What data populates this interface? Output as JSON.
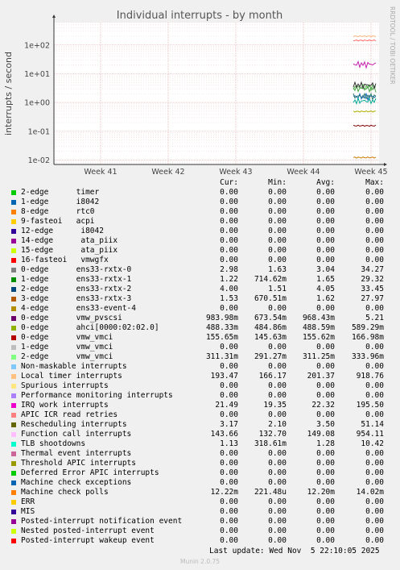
{
  "chart_data": {
    "type": "line",
    "title": "Individual interrupts - by month",
    "ylabel": "interrupts / second",
    "yscale": "log",
    "ylim": [
      0.007,
      600
    ],
    "y_ticks": [
      {
        "v": 100,
        "label": "1e+02"
      },
      {
        "v": 10,
        "label": "1e+01"
      },
      {
        "v": 1,
        "label": "1e+00"
      },
      {
        "v": 0.1,
        "label": "1e-01"
      },
      {
        "v": 0.01,
        "label": "1e-02"
      }
    ],
    "x_ticks": [
      "Week 41",
      "Week 42",
      "Week 43",
      "Week 44",
      "Week 45"
    ],
    "grid": true,
    "side_text": "RRDTOOL / TOBI OETIKER",
    "series_visible": [
      {
        "color": "#f8b67e",
        "level": 201.37
      },
      {
        "color": "#ff6a6a",
        "level": 143.66
      },
      {
        "color": "#c51eb0",
        "level": 21.49
      },
      {
        "color": "#5db055",
        "level": 3.5
      },
      {
        "color": "#4da84a",
        "level": 3.04
      },
      {
        "color": "#333333",
        "level": 4.05
      },
      {
        "color": "#1565c0",
        "level": 1.62
      },
      {
        "color": "#2e7d6b",
        "level": 1.65
      },
      {
        "color": "#00a896",
        "level": 1.13
      },
      {
        "color": "#b0b000",
        "level": 0.4883
      },
      {
        "color": "#7d0000",
        "level": 0.1557
      },
      {
        "color": "#cc7a00",
        "level": 0.01222
      }
    ]
  },
  "legend": {
    "headers": [
      "Cur:",
      "Min:",
      "Avg:",
      "Max:"
    ],
    "rows": [
      {
        "name": "2-edge      timer",
        "color": "#00cc00",
        "cur": "0.00",
        "min": "0.00",
        "avg": "0.00",
        "max": "0.00"
      },
      {
        "name": "1-edge      i8042",
        "color": "#0066b3",
        "cur": "0.00",
        "min": "0.00",
        "avg": "0.00",
        "max": "0.00"
      },
      {
        "name": "8-edge      rtc0",
        "color": "#ff8000",
        "cur": "0.00",
        "min": "0.00",
        "avg": "0.00",
        "max": "0.00"
      },
      {
        "name": "9-fasteoi   acpi",
        "color": "#ffcc00",
        "cur": "0.00",
        "min": "0.00",
        "avg": "0.00",
        "max": "0.00"
      },
      {
        "name": "12-edge      i8042",
        "color": "#330099",
        "cur": "0.00",
        "min": "0.00",
        "avg": "0.00",
        "max": "0.00"
      },
      {
        "name": "14-edge      ata_piix",
        "color": "#990099",
        "cur": "0.00",
        "min": "0.00",
        "avg": "0.00",
        "max": "0.00"
      },
      {
        "name": "15-edge      ata_piix",
        "color": "#ccff00",
        "cur": "0.00",
        "min": "0.00",
        "avg": "0.00",
        "max": "0.00"
      },
      {
        "name": "16-fasteoi   vmwgfx",
        "color": "#ff0000",
        "cur": "0.00",
        "min": "0.00",
        "avg": "0.00",
        "max": "0.00"
      },
      {
        "name": "0-edge      ens33-rxtx-0",
        "color": "#808080",
        "cur": "2.98",
        "min": "1.63",
        "avg": "3.04",
        "max": "34.27"
      },
      {
        "name": "1-edge      ens33-rxtx-1",
        "color": "#008f00",
        "cur": "1.22",
        "min": "714.62m",
        "avg": "1.65",
        "max": "29.32"
      },
      {
        "name": "2-edge      ens33-rxtx-2",
        "color": "#00487d",
        "cur": "4.00",
        "min": "1.51",
        "avg": "4.05",
        "max": "33.45"
      },
      {
        "name": "3-edge      ens33-rxtx-3",
        "color": "#b35a00",
        "cur": "1.53",
        "min": "670.51m",
        "avg": "1.62",
        "max": "27.97"
      },
      {
        "name": "4-edge      ens33-event-4",
        "color": "#b38f00",
        "cur": "0.00",
        "min": "0.00",
        "avg": "0.00",
        "max": "0.00"
      },
      {
        "name": "0-edge      vmw_pvscsi",
        "color": "#6b006b",
        "cur": "983.98m",
        "min": "673.54m",
        "avg": "968.43m",
        "max": "5.21"
      },
      {
        "name": "0-edge      ahci[0000:02:02.0]",
        "color": "#8fb300",
        "cur": "488.33m",
        "min": "484.86m",
        "avg": "488.59m",
        "max": "589.29m"
      },
      {
        "name": "0-edge      vmw_vmci",
        "color": "#b30000",
        "cur": "155.65m",
        "min": "145.63m",
        "avg": "155.62m",
        "max": "166.98m"
      },
      {
        "name": "1-edge      vmw_vmci",
        "color": "#bebebe",
        "cur": "0.00",
        "min": "0.00",
        "avg": "0.00",
        "max": "0.00"
      },
      {
        "name": "2-edge      vmw_vmci",
        "color": "#80ff80",
        "cur": "311.31m",
        "min": "291.27m",
        "avg": "311.25m",
        "max": "333.96m"
      },
      {
        "name": "Non-maskable interrupts",
        "color": "#80c9ff",
        "cur": "0.00",
        "min": "0.00",
        "avg": "0.00",
        "max": "0.00"
      },
      {
        "name": "Local timer interrupts",
        "color": "#ffc080",
        "cur": "193.47",
        "min": "166.17",
        "avg": "201.37",
        "max": "918.76"
      },
      {
        "name": "Spurious interrupts",
        "color": "#ffe680",
        "cur": "0.00",
        "min": "0.00",
        "avg": "0.00",
        "max": "0.00"
      },
      {
        "name": "Performance monitoring interrupts",
        "color": "#aa80ff",
        "cur": "0.00",
        "min": "0.00",
        "avg": "0.00",
        "max": "0.00"
      },
      {
        "name": "IRQ work interrupts",
        "color": "#ee00cc",
        "cur": "21.49",
        "min": "19.35",
        "avg": "22.32",
        "max": "195.50"
      },
      {
        "name": "APIC ICR read retries",
        "color": "#ff8080",
        "cur": "0.00",
        "min": "0.00",
        "avg": "0.00",
        "max": "0.00"
      },
      {
        "name": "Rescheduling interrupts",
        "color": "#666600",
        "cur": "3.17",
        "min": "2.10",
        "avg": "3.50",
        "max": "51.14"
      },
      {
        "name": "Function call interrupts",
        "color": "#ffbfff",
        "cur": "143.66",
        "min": "132.70",
        "avg": "149.08",
        "max": "954.11"
      },
      {
        "name": "TLB shootdowns",
        "color": "#00ffcc",
        "cur": "1.13",
        "min": "318.61m",
        "avg": "1.28",
        "max": "10.42"
      },
      {
        "name": "Thermal event interrupts",
        "color": "#cc6699",
        "cur": "0.00",
        "min": "0.00",
        "avg": "0.00",
        "max": "0.00"
      },
      {
        "name": "Threshold APIC interrupts",
        "color": "#999900",
        "cur": "0.00",
        "min": "0.00",
        "avg": "0.00",
        "max": "0.00"
      },
      {
        "name": "Deferred Error APIC interrupts",
        "color": "#00cc00",
        "cur": "0.00",
        "min": "0.00",
        "avg": "0.00",
        "max": "0.00"
      },
      {
        "name": "Machine check exceptions",
        "color": "#0066b3",
        "cur": "0.00",
        "min": "0.00",
        "avg": "0.00",
        "max": "0.00"
      },
      {
        "name": "Machine check polls",
        "color": "#ff8000",
        "cur": "12.22m",
        "min": "221.48u",
        "avg": "12.20m",
        "max": "14.02m"
      },
      {
        "name": "ERR",
        "color": "#ffcc00",
        "cur": "0.00",
        "min": "0.00",
        "avg": "0.00",
        "max": "0.00"
      },
      {
        "name": "MIS",
        "color": "#330099",
        "cur": "0.00",
        "min": "0.00",
        "avg": "0.00",
        "max": "0.00"
      },
      {
        "name": "Posted-interrupt notification event",
        "color": "#990099",
        "cur": "0.00",
        "min": "0.00",
        "avg": "0.00",
        "max": "0.00"
      },
      {
        "name": "Nested posted-interrupt event",
        "color": "#ccff00",
        "cur": "0.00",
        "min": "0.00",
        "avg": "0.00",
        "max": "0.00"
      },
      {
        "name": "Posted-interrupt wakeup event",
        "color": "#ff0000",
        "cur": "0.00",
        "min": "0.00",
        "avg": "0.00",
        "max": "0.00"
      }
    ]
  },
  "footer": {
    "last_update": "Last update: Wed Nov  5 22:10:05 2025",
    "munin": "Munin 2.0.75"
  }
}
